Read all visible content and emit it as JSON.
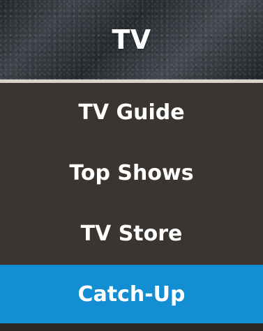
{
  "header": {
    "title": "TV"
  },
  "menu": {
    "items": [
      {
        "label": "TV Guide",
        "selected": false
      },
      {
        "label": "Top Shows",
        "selected": false
      },
      {
        "label": "TV Store",
        "selected": false
      },
      {
        "label": "Catch-Up",
        "selected": true
      }
    ]
  },
  "colors": {
    "selected_background": "#148ed2",
    "menu_background": "#3a3530",
    "divider": "#d8d4cc",
    "text": "#ffffff"
  }
}
